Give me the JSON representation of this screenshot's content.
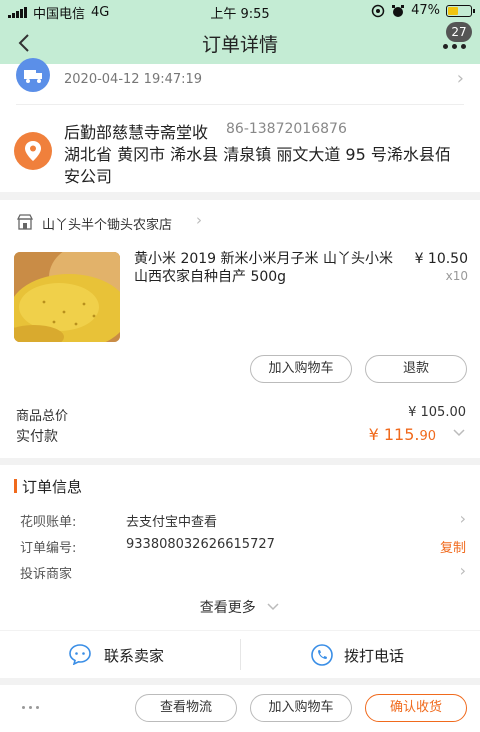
{
  "status_bar": {
    "carrier": "中国电信",
    "network": "4G",
    "time": "上午 9:55",
    "battery": "47%",
    "battery_level": 0.47
  },
  "nav": {
    "title": "订单详情",
    "badge": "27"
  },
  "logistics": {
    "time": "2020-04-12 19:47:19"
  },
  "address": {
    "name": "后勤部慈慧寺斋堂收",
    "phone": "86-13872016876",
    "full": "湖北省 黄冈市 浠水县 清泉镇 丽文大道 95 号浠水县佰安公司"
  },
  "shop": {
    "name": "山丫头半个锄头农家店"
  },
  "product": {
    "title": "黄小米 2019 新米小米月子米 山丫头小米山西农家自种自产 500g",
    "price": "¥ 10.50",
    "qty": "x10",
    "add_cart_label": "加入购物车",
    "refund_label": "退款"
  },
  "summary": {
    "total_label": "商品总价",
    "total_value": "¥ 105.00",
    "paid_label": "实付款",
    "paid_main": "¥ 115.",
    "paid_cents": "90"
  },
  "order_info": {
    "title": "订单信息",
    "rows": [
      {
        "key": "花呗账单:",
        "value": "去支付宝中查看"
      },
      {
        "key": "订单编号:",
        "value": "933808032626615727",
        "action": "复制"
      },
      {
        "key": "投诉商家",
        "value": ""
      }
    ],
    "more_label": "查看更多"
  },
  "contact": {
    "seller_label": "联系卖家",
    "phone_label": "拨打电话"
  },
  "footer": {
    "logistics_label": "查看物流",
    "add_cart_label": "加入购物车",
    "confirm_label": "确认收货"
  },
  "colors": {
    "header_bg": "#c4ecd4",
    "accent": "#f06a1d",
    "truck_blue": "#5b8fe8",
    "pin_orange": "#f0803c"
  }
}
